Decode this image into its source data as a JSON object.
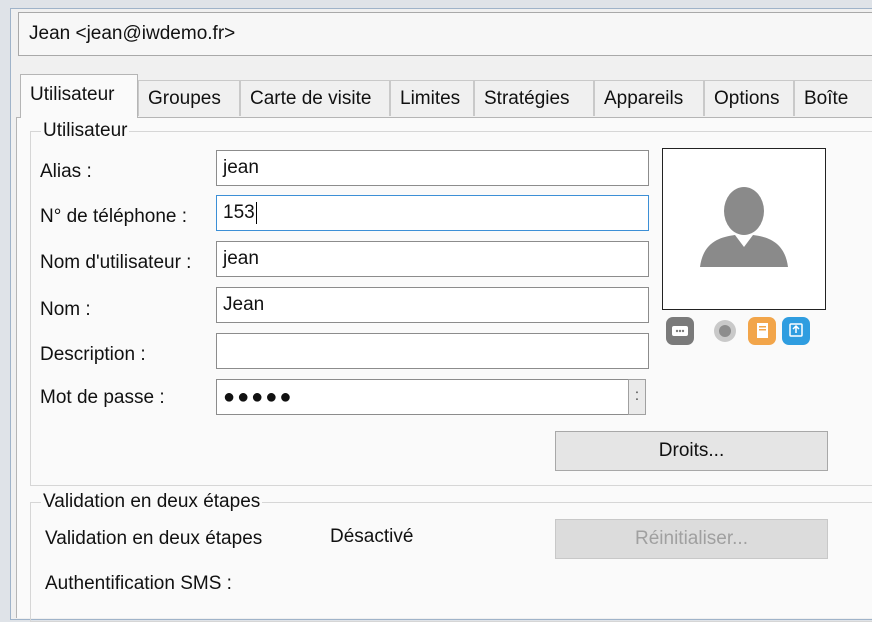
{
  "window": {
    "title": "Jean <jean@iwdemo.fr>"
  },
  "tabs": [
    {
      "label": "Utilisateur",
      "active": true
    },
    {
      "label": "Groupes"
    },
    {
      "label": "Carte de visite"
    },
    {
      "label": "Limites"
    },
    {
      "label": "Stratégies"
    },
    {
      "label": "Appareils"
    },
    {
      "label": "Options"
    },
    {
      "label": "Boîte"
    }
  ],
  "user_group": {
    "title": "Utilisateur",
    "alias_label": "Alias :",
    "alias_value": "jean",
    "phone_label": "N° de téléphone :",
    "phone_value": "153",
    "username_label": "Nom d'utilisateur :",
    "username_value": "jean",
    "name_label": "Nom :",
    "name_value": "Jean",
    "description_label": "Description :",
    "description_value": "",
    "password_label": "Mot de passe :",
    "password_value": "●●●●●",
    "password_more": ":",
    "rights_button": "Droits..."
  },
  "photo": {
    "avatar_icon": "user-silhouette-icon",
    "actions": [
      {
        "icon": "camera-icon",
        "color": "#7a7a7a"
      },
      {
        "icon": "record-icon",
        "color": "#9a9a9a"
      },
      {
        "icon": "file-icon",
        "color": "#f2a54a"
      },
      {
        "icon": "upload-icon",
        "color": "#2f9de0"
      }
    ]
  },
  "twofa_group": {
    "title": "Validation en deux étapes",
    "row_label": "Validation en deux étapes",
    "status": "Désactivé",
    "reset_button": "Réinitialiser...",
    "sms_label": "Authentification SMS :"
  },
  "colors": {
    "focus_border": "#3c8fd6",
    "avatar_grey": "#8a8a8a"
  }
}
